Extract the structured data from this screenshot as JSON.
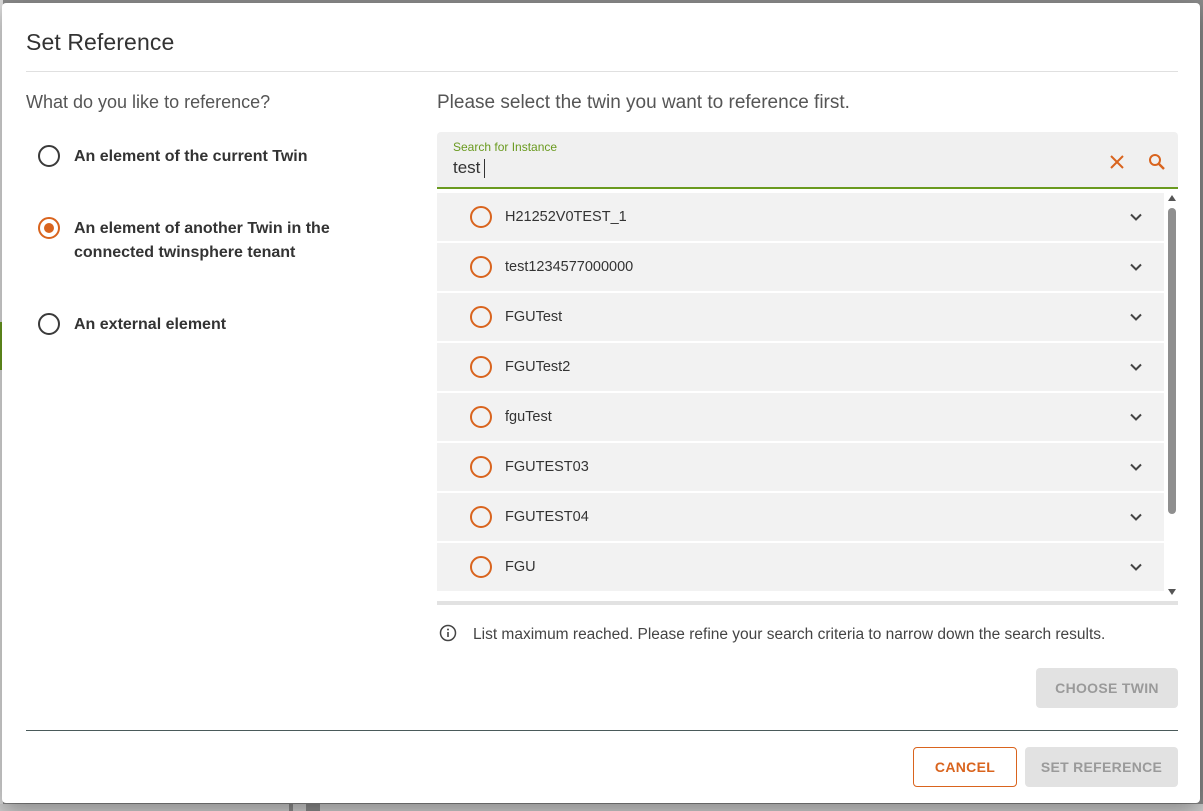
{
  "dialog": {
    "title": "Set Reference"
  },
  "left": {
    "heading": "What do you like to reference?",
    "options": [
      {
        "label": "An element of the current Twin",
        "checked": false
      },
      {
        "label": "An element of another Twin in the connected twinsphere tenant",
        "checked": true
      },
      {
        "label": "An external element",
        "checked": false
      }
    ]
  },
  "right": {
    "heading": "Please select the twin you want to reference first.",
    "search": {
      "label": "Search for Instance",
      "value": "test",
      "clear_icon": "close-icon",
      "search_icon": "search-icon"
    },
    "items": [
      {
        "label": "H21252V0TEST_1"
      },
      {
        "label": "test1234577000000"
      },
      {
        "label": "FGUTest"
      },
      {
        "label": "FGUTest2"
      },
      {
        "label": "fguTest"
      },
      {
        "label": "FGUTEST03"
      },
      {
        "label": "FGUTEST04"
      },
      {
        "label": "FGU"
      }
    ],
    "info_text": "List maximum reached. Please refine your search criteria to narrow down the search results.",
    "choose_label": "CHOOSE TWIN"
  },
  "footer": {
    "cancel_label": "CANCEL",
    "set_label": "SET REFERENCE"
  },
  "colors": {
    "accent": "#d9641e",
    "focus": "#6a9a1f",
    "disabled_bg": "#e2e2e2",
    "disabled_text": "#9a9a9a"
  }
}
